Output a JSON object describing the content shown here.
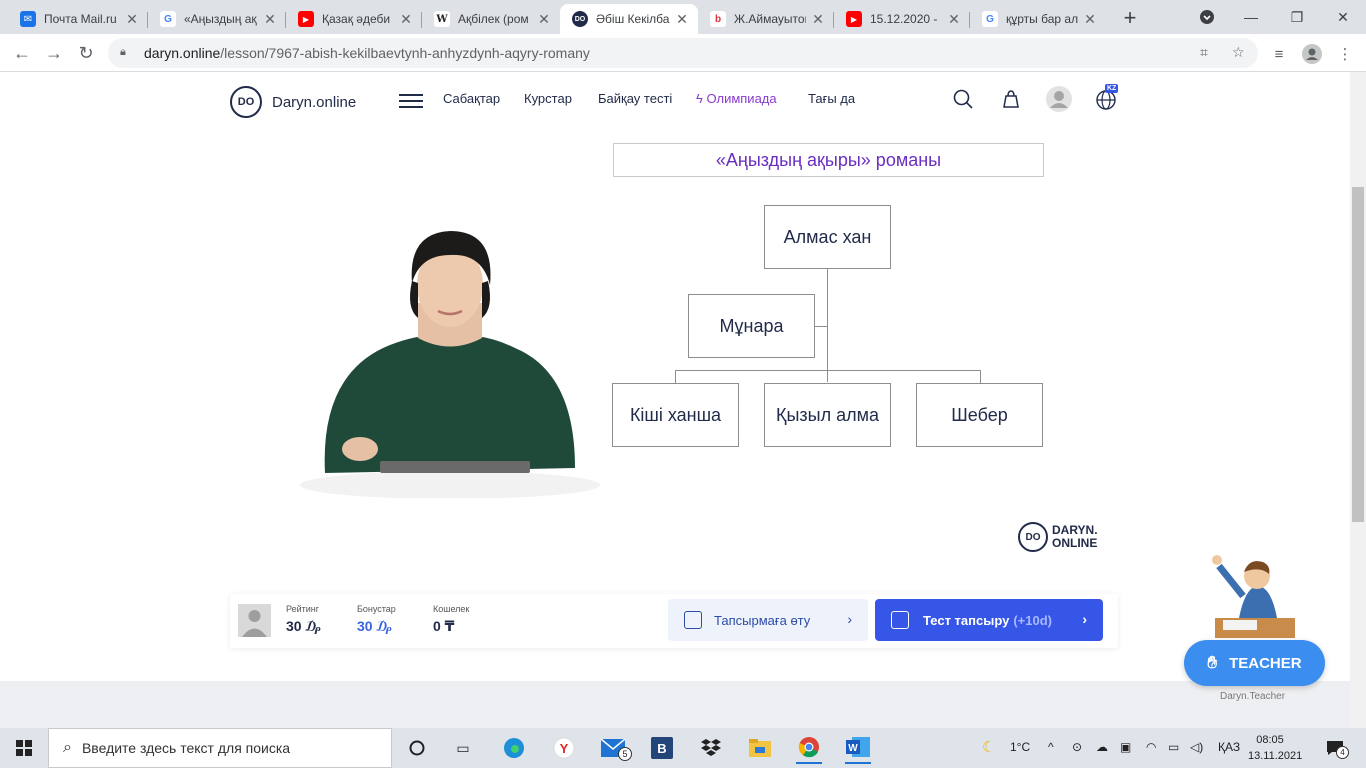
{
  "browser": {
    "tabs": [
      {
        "title": "Почта Mail.ru",
        "favicon": "mail-icon",
        "color": "#1a73e8"
      },
      {
        "title": "«Аңыздың ақ",
        "favicon": "google-icon",
        "color": "#ffffff"
      },
      {
        "title": "Қазақ әдеби",
        "favicon": "youtube-icon",
        "color": "#ff0000"
      },
      {
        "title": "Ақбілек (ром",
        "favicon": "wikipedia-icon",
        "color": "#ffffff"
      },
      {
        "title": "Әбіш Кекілба",
        "favicon": "daryn-icon",
        "color": "#222c4a"
      },
      {
        "title": "Ж.Аймауытов",
        "favicon": "site-icon",
        "color": "#e0303a"
      },
      {
        "title": "15.12.2020 - ",
        "favicon": "youtube-icon",
        "color": "#ff0000"
      },
      {
        "title": "құрты бар ал",
        "favicon": "google-icon",
        "color": "#ffffff"
      }
    ],
    "url_host": "daryn.online",
    "url_path": "/lesson/7967-abish-kekilbaevtynh-anhyzdynh-aqyry-romany"
  },
  "site": {
    "logo_mark": "DO",
    "logo_text": "Daryn.online",
    "nav": [
      "Сабақтар",
      "Курстар",
      "Байқау тесті",
      "Олимпиада",
      "Тағы да"
    ],
    "lang_badge": "KZ"
  },
  "slide": {
    "title": "«Аңыздың ақыры» романы",
    "nodes": {
      "root": "Алмас хан",
      "left": "Мұнара",
      "b1": "Кіші ханша",
      "b2": "Қызыл алма",
      "b3": "Шебер"
    },
    "watermark_mark": "DO",
    "watermark_line1": "DARYN.",
    "watermark_line2": "ONLINE"
  },
  "stats": {
    "rating_label": "Рейтинг",
    "rating_value": "30 ₯",
    "bonus_label": "Бонустар",
    "bonus_value": "30 ₯",
    "wallet_label": "Кошелек",
    "wallet_value": "0 ₸",
    "task_button": "Тапсырмаға өту",
    "test_button": "Тест тапсыру",
    "test_bonus": "(+10d)"
  },
  "teacher": {
    "button": "TEACHER",
    "caption": "Daryn.Teacher"
  },
  "taskbar": {
    "search_placeholder": "Введите здесь текст для поиска",
    "mail_badge": "5",
    "temperature": "1°C",
    "language": "ҚАЗ",
    "time": "08:05",
    "date": "13.11.2021",
    "notifications": "4"
  },
  "colors": {
    "accent_blue": "#3656e8",
    "title_purple": "#6a2fc0",
    "olympiad_purple": "#8a3ccf",
    "teacher_blue": "#3b8df0"
  }
}
